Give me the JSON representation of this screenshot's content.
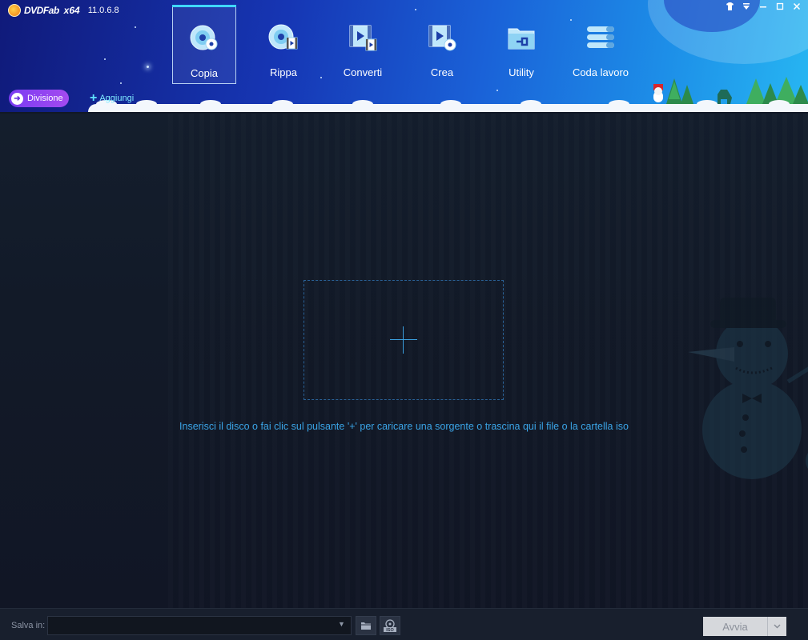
{
  "app": {
    "brand": "DVDFab",
    "arch": "x64",
    "version": "11.0.6.8"
  },
  "window_controls": [
    "skin-icon",
    "menu-icon",
    "minimize-icon",
    "maximize-icon",
    "close-icon"
  ],
  "nav": {
    "active": "Copia",
    "items": [
      {
        "label": "Copia",
        "icon": "disc-copy-icon"
      },
      {
        "label": "Rippa",
        "icon": "disc-rip-icon"
      },
      {
        "label": "Converti",
        "icon": "video-convert-icon"
      },
      {
        "label": "Crea",
        "icon": "video-create-icon"
      },
      {
        "label": "Utility",
        "icon": "folder-tools-icon"
      },
      {
        "label": "Coda lavoro",
        "icon": "queue-stack-icon"
      }
    ]
  },
  "toolbar": {
    "mode_label": "Divisione",
    "add_label": "Aggiungi"
  },
  "main": {
    "hint": "Inserisci il disco o fai clic sul pulsante '+' per caricare una sorgente o trascina qui il file o la cartella iso"
  },
  "bottom": {
    "save_label": "Salva in:",
    "save_value": "",
    "start_label": "Avvia"
  },
  "colors": {
    "accent": "#3aa4e6",
    "header_dark": "#101a7a",
    "header_light": "#27b6f2",
    "mode_pill": "#8a42f0"
  }
}
